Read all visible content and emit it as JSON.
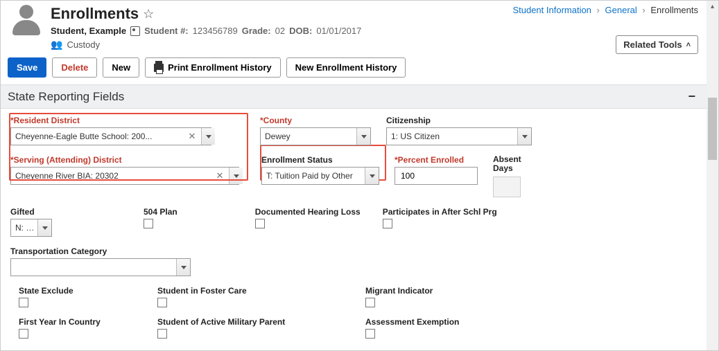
{
  "header": {
    "title": "Enrollments",
    "student_name": "Student, Example",
    "student_num_label": "Student #:",
    "student_num": "123456789",
    "grade_label": "Grade:",
    "grade": "02",
    "dob_label": "DOB:",
    "dob": "01/01/2017",
    "custody": "Custody",
    "related_tools": "Related Tools"
  },
  "breadcrumb": [
    "Student Information",
    "General",
    "Enrollments"
  ],
  "actions": {
    "save": "Save",
    "delete": "Delete",
    "new": "New",
    "print_history": "Print Enrollment History",
    "new_history": "New Enrollment History"
  },
  "section": {
    "title": "State Reporting Fields"
  },
  "fields": {
    "resident_district": {
      "label": "Resident District",
      "value": "Cheyenne-Eagle Butte School: 200..."
    },
    "serving_district": {
      "label": "Serving (Attending) District",
      "value": "Cheyenne River BIA: 20302"
    },
    "county": {
      "label": "County",
      "value": "Dewey"
    },
    "citizenship": {
      "label": "Citizenship",
      "value": "1: US Citizen"
    },
    "enrollment_status": {
      "label": "Enrollment Status",
      "value": "T: Tuition Paid by Other"
    },
    "percent_enrolled": {
      "label": "Percent Enrolled",
      "value": "100"
    },
    "absent_days": {
      "label": "Absent\nDays"
    },
    "gifted": {
      "label": "Gifted",
      "value": "N: No"
    },
    "plan504": {
      "label": "504 Plan"
    },
    "hearing_loss": {
      "label": "Documented Hearing Loss"
    },
    "after_school": {
      "label": "Participates in After Schl Prg"
    },
    "transportation": {
      "label": "Transportation Category",
      "value": ""
    },
    "state_exclude": {
      "label": "State Exclude"
    },
    "foster_care": {
      "label": "Student in Foster Care"
    },
    "migrant": {
      "label": "Migrant Indicator"
    },
    "first_year": {
      "label": "First Year In Country"
    },
    "military_parent": {
      "label": "Student of Active Military Parent"
    },
    "assessment_exemption": {
      "label": "Assessment Exemption"
    }
  }
}
